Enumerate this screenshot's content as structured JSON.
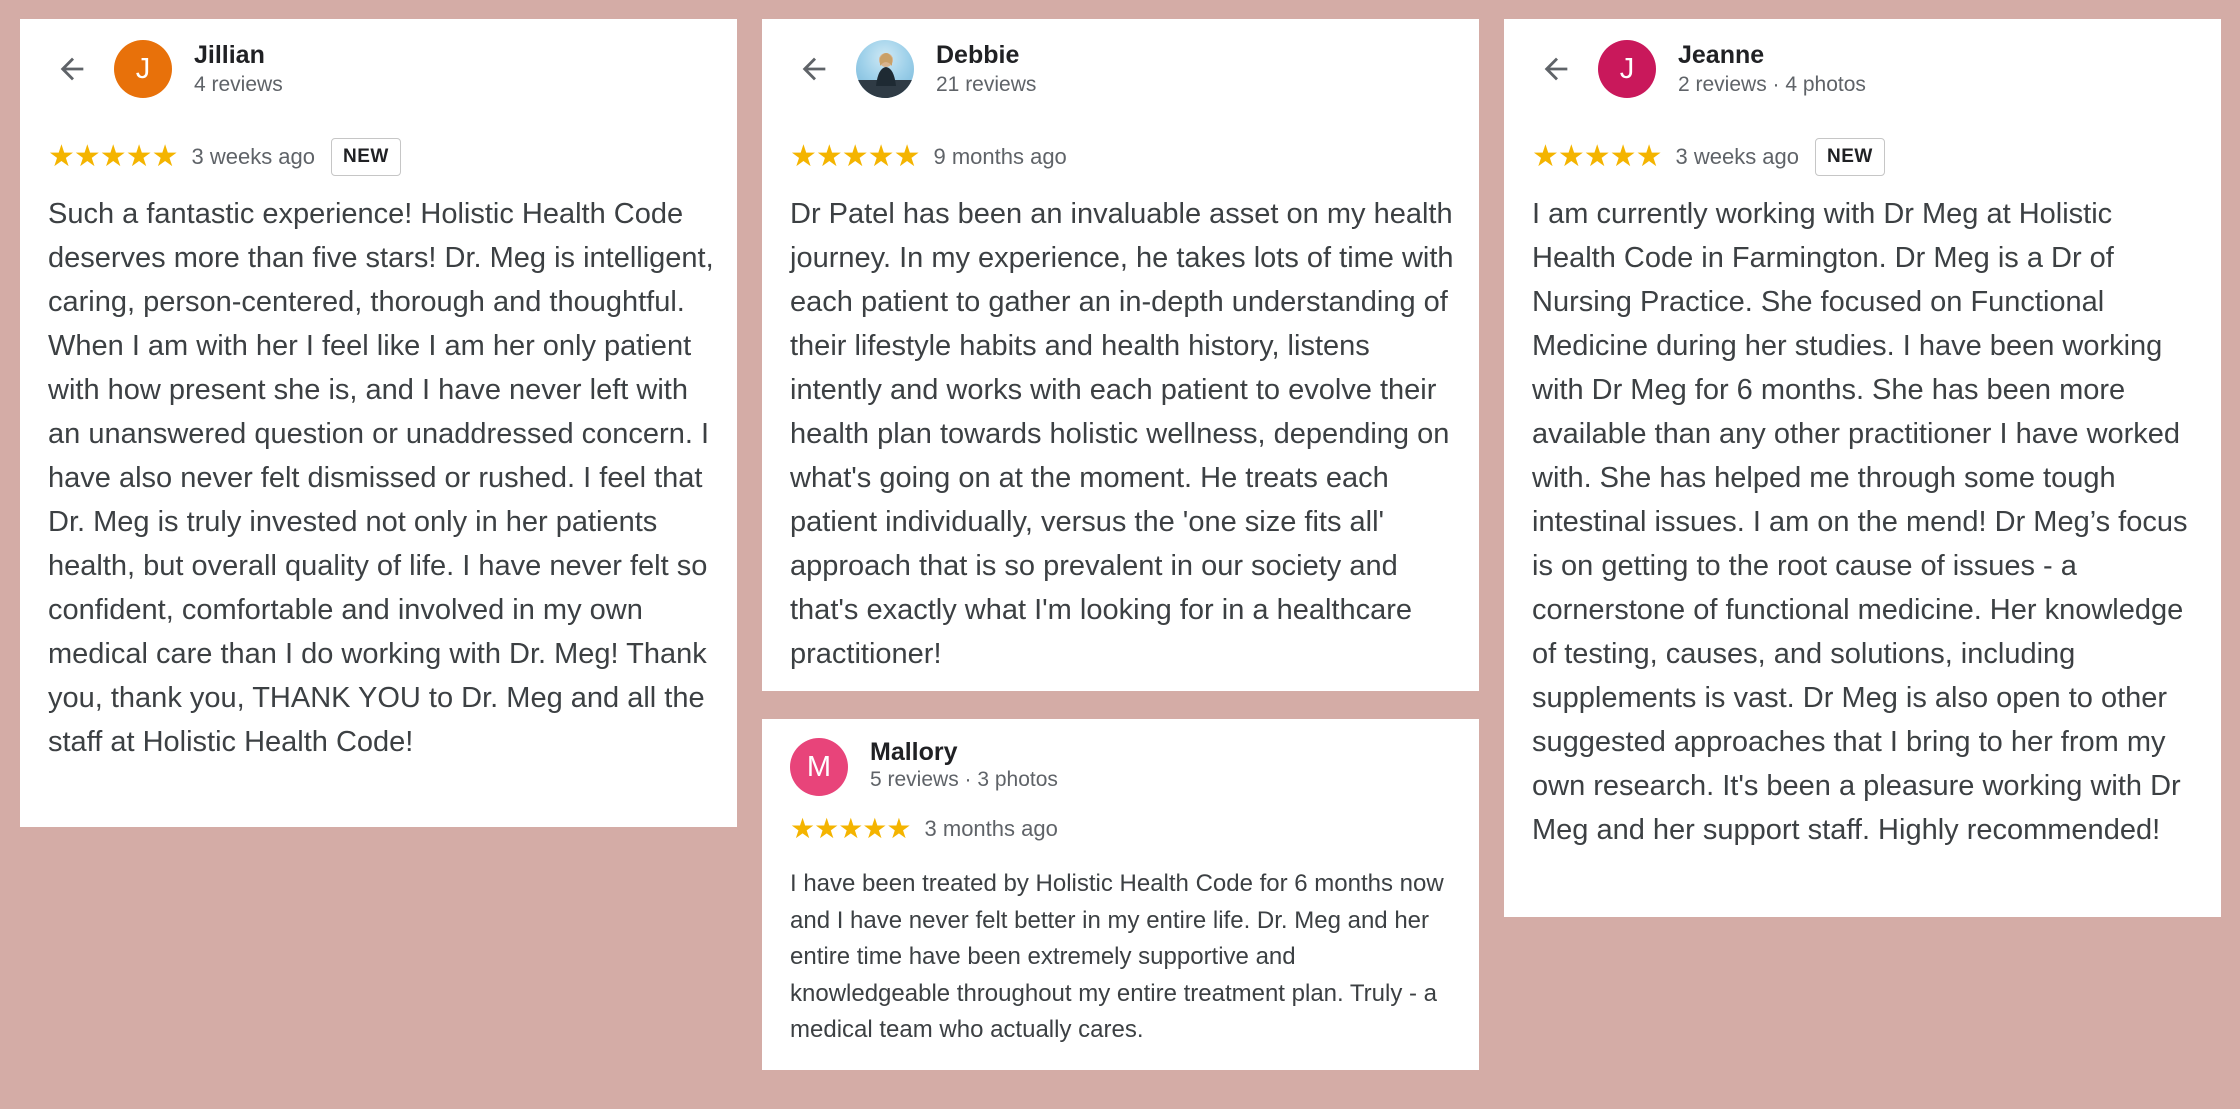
{
  "colors": {
    "background": "#d4aca6",
    "star": "#f4b400",
    "avatar_jillian": "#e8710a",
    "avatar_jeanne": "#c9185b",
    "avatar_mallory": "#e8447a"
  },
  "icons": {
    "back": "arrow-left-icon",
    "star": "star-icon"
  },
  "reviews": [
    {
      "name": "Jillian",
      "initial": "J",
      "meta": "4 reviews",
      "stars": "★★★★★",
      "rating": 5,
      "age": "3 weeks ago",
      "badge": "NEW",
      "text": "Such a fantastic experience! Holistic Health Code deserves more than five stars! Dr. Meg is intelligent, caring, person-centered, thorough and thoughtful. When I am with her I feel like I am her only patient with how present she is, and I have never left with an unanswered question or unaddressed concern. I have also never felt dismissed or rushed. I feel that Dr. Meg is truly invested not only in her patients health, but overall quality of life. I have never felt so confident, comfortable and involved in my own medical care than I do working with Dr. Meg! Thank you, thank you, THANK YOU to Dr. Meg and all the staff at Holistic Health Code!"
    },
    {
      "name": "Debbie",
      "meta": "21 reviews",
      "stars": "★★★★★",
      "rating": 5,
      "age": "9 months ago",
      "text": "Dr Patel has been an invaluable asset on my health journey. In my experience, he takes lots of time with each patient to gather an in-depth understanding of their lifestyle habits and health history, listens intently and works with each patient to evolve their health plan towards holistic wellness, depending on what's going on at the moment. He treats each patient individually, versus the 'one size fits all' approach that is so prevalent in our society and that's exactly what I'm looking for in a healthcare practitioner!"
    },
    {
      "name": "Mallory",
      "initial": "M",
      "meta": "5 reviews · 3 photos",
      "stars": "★★★★★",
      "rating": 5,
      "age": "3 months ago",
      "text": "I have been treated by Holistic Health Code for 6 months now and I have never felt better in my entire life. Dr. Meg and her entire time have been extremely supportive and knowledgeable throughout my entire treatment plan. Truly - a medical team who actually cares."
    },
    {
      "name": "Jeanne",
      "initial": "J",
      "meta": "2 reviews · 4 photos",
      "stars": "★★★★★",
      "rating": 5,
      "age": "3 weeks ago",
      "badge": "NEW",
      "text": "I am currently working with Dr Meg at Holistic Health Code in Farmington. Dr Meg is a Dr of Nursing Practice. She focused on Functional Medicine during her studies. I have been working with Dr Meg for 6 months. She has been more available than any other practitioner I have worked with. She has helped me through some tough intestinal issues. I am on the mend! Dr Meg’s focus is on getting to the root cause of issues - a cornerstone of functional medicine. Her knowledge of testing, causes, and solutions, including supplements is vast. Dr Meg is also open to other suggested approaches that I bring to her from my own research. It's been a pleasure working with Dr Meg and her support staff. Highly recommended!"
    }
  ]
}
